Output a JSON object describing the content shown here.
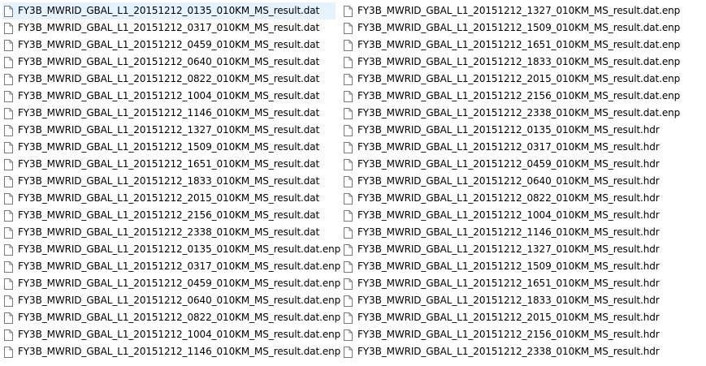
{
  "selected_file": "FY3B_MWRID_GBAL_L1_20151212_0135_010KM_MS_result.dat",
  "file_icon": "generic-file-icon",
  "colors": {
    "selection": "#e5f3ff",
    "icon_stroke": "#7a7a7a",
    "text": "#000000"
  },
  "files_left": [
    "FY3B_MWRID_GBAL_L1_20151212_0135_010KM_MS_result.dat",
    "FY3B_MWRID_GBAL_L1_20151212_0317_010KM_MS_result.dat",
    "FY3B_MWRID_GBAL_L1_20151212_0459_010KM_MS_result.dat",
    "FY3B_MWRID_GBAL_L1_20151212_0640_010KM_MS_result.dat",
    "FY3B_MWRID_GBAL_L1_20151212_0822_010KM_MS_result.dat",
    "FY3B_MWRID_GBAL_L1_20151212_1004_010KM_MS_result.dat",
    "FY3B_MWRID_GBAL_L1_20151212_1146_010KM_MS_result.dat",
    "FY3B_MWRID_GBAL_L1_20151212_1327_010KM_MS_result.dat",
    "FY3B_MWRID_GBAL_L1_20151212_1509_010KM_MS_result.dat",
    "FY3B_MWRID_GBAL_L1_20151212_1651_010KM_MS_result.dat",
    "FY3B_MWRID_GBAL_L1_20151212_1833_010KM_MS_result.dat",
    "FY3B_MWRID_GBAL_L1_20151212_2015_010KM_MS_result.dat",
    "FY3B_MWRID_GBAL_L1_20151212_2156_010KM_MS_result.dat",
    "FY3B_MWRID_GBAL_L1_20151212_2338_010KM_MS_result.dat",
    "FY3B_MWRID_GBAL_L1_20151212_0135_010KM_MS_result.dat.enp",
    "FY3B_MWRID_GBAL_L1_20151212_0317_010KM_MS_result.dat.enp",
    "FY3B_MWRID_GBAL_L1_20151212_0459_010KM_MS_result.dat.enp",
    "FY3B_MWRID_GBAL_L1_20151212_0640_010KM_MS_result.dat.enp",
    "FY3B_MWRID_GBAL_L1_20151212_0822_010KM_MS_result.dat.enp",
    "FY3B_MWRID_GBAL_L1_20151212_1004_010KM_MS_result.dat.enp",
    "FY3B_MWRID_GBAL_L1_20151212_1146_010KM_MS_result.dat.enp"
  ],
  "files_right": [
    "FY3B_MWRID_GBAL_L1_20151212_1327_010KM_MS_result.dat.enp",
    "FY3B_MWRID_GBAL_L1_20151212_1509_010KM_MS_result.dat.enp",
    "FY3B_MWRID_GBAL_L1_20151212_1651_010KM_MS_result.dat.enp",
    "FY3B_MWRID_GBAL_L1_20151212_1833_010KM_MS_result.dat.enp",
    "FY3B_MWRID_GBAL_L1_20151212_2015_010KM_MS_result.dat.enp",
    "FY3B_MWRID_GBAL_L1_20151212_2156_010KM_MS_result.dat.enp",
    "FY3B_MWRID_GBAL_L1_20151212_2338_010KM_MS_result.dat.enp",
    "FY3B_MWRID_GBAL_L1_20151212_0135_010KM_MS_result.hdr",
    "FY3B_MWRID_GBAL_L1_20151212_0317_010KM_MS_result.hdr",
    "FY3B_MWRID_GBAL_L1_20151212_0459_010KM_MS_result.hdr",
    "FY3B_MWRID_GBAL_L1_20151212_0640_010KM_MS_result.hdr",
    "FY3B_MWRID_GBAL_L1_20151212_0822_010KM_MS_result.hdr",
    "FY3B_MWRID_GBAL_L1_20151212_1004_010KM_MS_result.hdr",
    "FY3B_MWRID_GBAL_L1_20151212_1146_010KM_MS_result.hdr",
    "FY3B_MWRID_GBAL_L1_20151212_1327_010KM_MS_result.hdr",
    "FY3B_MWRID_GBAL_L1_20151212_1509_010KM_MS_result.hdr",
    "FY3B_MWRID_GBAL_L1_20151212_1651_010KM_MS_result.hdr",
    "FY3B_MWRID_GBAL_L1_20151212_1833_010KM_MS_result.hdr",
    "FY3B_MWRID_GBAL_L1_20151212_2015_010KM_MS_result.hdr",
    "FY3B_MWRID_GBAL_L1_20151212_2156_010KM_MS_result.hdr",
    "FY3B_MWRID_GBAL_L1_20151212_2338_010KM_MS_result.hdr"
  ]
}
